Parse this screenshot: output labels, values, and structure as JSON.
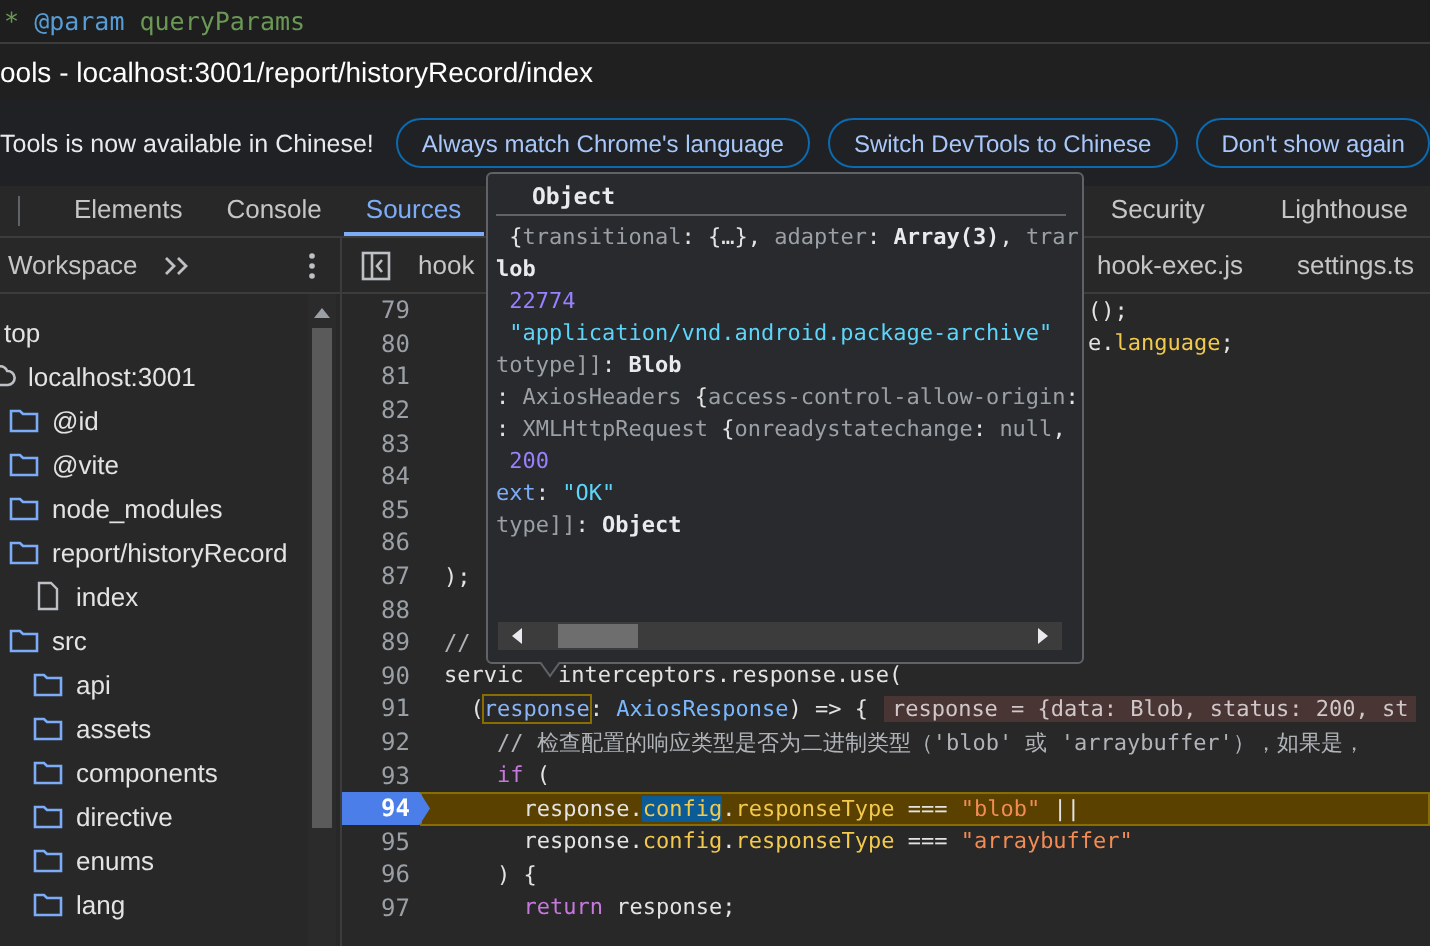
{
  "editor_above": {
    "tokens": [
      {
        "kind": "green",
        "text": "* "
      },
      {
        "kind": "blue",
        "text": "@param"
      },
      {
        "kind": "green",
        "text": " queryParams"
      }
    ]
  },
  "window": {
    "title": "ools - localhost:3001/report/historyRecord/index"
  },
  "infobar": {
    "message": "Tools is now available in Chinese!",
    "buttons": [
      "Always match Chrome's language",
      "Switch DevTools to Chinese",
      "Don't show again"
    ]
  },
  "tabs": [
    {
      "label": "Elements",
      "selected": false
    },
    {
      "label": "Console",
      "selected": false
    },
    {
      "label": "Sources",
      "selected": true
    },
    {
      "label": "Security",
      "selected": false
    },
    {
      "label": "Lighthouse",
      "selected": false
    }
  ],
  "sidebar": {
    "title": "Workspace",
    "tree": [
      {
        "label": "top",
        "children": [
          {
            "label": "localhost:3001",
            "kind": "origin",
            "children": [
              {
                "label": "@id",
                "kind": "folder"
              },
              {
                "label": "@vite",
                "kind": "folder"
              },
              {
                "label": "node_modules",
                "kind": "folder"
              },
              {
                "label": "report/historyRecord",
                "kind": "folder",
                "children": [
                  {
                    "label": "index",
                    "kind": "file"
                  }
                ]
              },
              {
                "label": "src",
                "kind": "folder",
                "children": [
                  {
                    "label": "api",
                    "kind": "folder"
                  },
                  {
                    "label": "assets",
                    "kind": "folder"
                  },
                  {
                    "label": "components",
                    "kind": "folder"
                  },
                  {
                    "label": "directive",
                    "kind": "folder"
                  },
                  {
                    "label": "enums",
                    "kind": "folder"
                  },
                  {
                    "label": "lang",
                    "kind": "folder"
                  }
                ]
              }
            ]
          }
        ]
      }
    ]
  },
  "file_tabs": [
    "hook",
    "hook-exec.js",
    "settings.ts"
  ],
  "code": {
    "lines": [
      {
        "number": "79",
        "paused": false,
        "after_popover": [
          {
            "kind": "plain",
            "text": "();"
          }
        ]
      },
      {
        "number": "80",
        "paused": false,
        "after_popover": [
          {
            "kind": "plain",
            "text": "e."
          },
          {
            "kind": "prop",
            "text": "language"
          },
          {
            "kind": "plain",
            "text": ";"
          }
        ]
      },
      {
        "number": "81",
        "paused": false
      },
      {
        "number": "82",
        "paused": false
      },
      {
        "number": "83",
        "paused": false
      },
      {
        "number": "84",
        "paused": false
      },
      {
        "number": "85",
        "paused": false
      },
      {
        "number": "86",
        "paused": false
      },
      {
        "number": "87",
        "paused": false,
        "tokens": [
          {
            "kind": "plain",
            "text": ");"
          }
        ]
      },
      {
        "number": "88",
        "paused": false
      },
      {
        "number": "89",
        "paused": false,
        "tokens": [
          {
            "kind": "comment",
            "text": "//"
          }
        ]
      },
      {
        "number": "90",
        "paused": false,
        "tokens": [
          {
            "kind": "plain",
            "text": "servic"
          }
        ],
        "after_pointer": [
          {
            "kind": "plain",
            "text": "interceptors.response.use("
          }
        ]
      },
      {
        "number": "91",
        "paused": false,
        "tokens": [
          {
            "kind": "plain",
            "text": "  ("
          },
          {
            "kind": "match",
            "text": "response"
          },
          {
            "kind": "plain",
            "text": ": "
          },
          {
            "kind": "type",
            "text": "AxiosResponse"
          },
          {
            "kind": "plain",
            "text": ") => {"
          }
        ],
        "inline_value": "response = {data: Blob, status: 200, st"
      },
      {
        "number": "92",
        "paused": false,
        "tokens": [
          {
            "kind": "comment",
            "text": "    // 检查配置的响应类型是否为二进制类型（'blob' 或 'arraybuffer'），如果是，"
          }
        ]
      },
      {
        "number": "93",
        "paused": false,
        "tokens": [
          {
            "kind": "kw",
            "text": "    if"
          },
          {
            "kind": "plain",
            "text": " ("
          }
        ]
      },
      {
        "number": "94",
        "paused": true,
        "tokens": [
          {
            "kind": "plain",
            "text": "      response."
          },
          {
            "kind": "selection",
            "text": "config"
          },
          {
            "kind": "plain",
            "text": "."
          },
          {
            "kind": "prop",
            "text": "responseType"
          },
          {
            "kind": "plain",
            "text": " === "
          },
          {
            "kind": "str",
            "text": "\"blob\""
          },
          {
            "kind": "plain",
            "text": " ||"
          }
        ]
      },
      {
        "number": "95",
        "paused": false,
        "tokens": [
          {
            "kind": "plain",
            "text": "      response."
          },
          {
            "kind": "prop",
            "text": "config"
          },
          {
            "kind": "plain",
            "text": "."
          },
          {
            "kind": "prop",
            "text": "responseType"
          },
          {
            "kind": "plain",
            "text": " === "
          },
          {
            "kind": "str",
            "text": "\"arraybuffer\""
          }
        ]
      },
      {
        "number": "96",
        "paused": false,
        "tokens": [
          {
            "kind": "plain",
            "text": "    ) {"
          }
        ]
      },
      {
        "number": "97",
        "paused": false,
        "tokens": [
          {
            "kind": "kw",
            "text": "      return"
          },
          {
            "kind": "plain",
            "text": " response;"
          }
        ]
      }
    ]
  },
  "popover": {
    "title": "Object",
    "lines": [
      [
        {
          "kind": "plain",
          "text": " {"
        },
        {
          "kind": "key",
          "text": "transitional"
        },
        {
          "kind": "plain",
          "text": ": {…}, "
        },
        {
          "kind": "key",
          "text": "adapter"
        },
        {
          "kind": "plain",
          "text": ": "
        },
        {
          "kind": "bold",
          "text": "Array(3)"
        },
        {
          "kind": "plain",
          "text": ", "
        },
        {
          "kind": "key",
          "text": "trar"
        }
      ],
      [
        {
          "kind": "bold",
          "text": "lob"
        }
      ],
      [
        {
          "kind": "num",
          "text": " 22774"
        }
      ],
      [
        {
          "kind": "pstr",
          "text": " \"application/vnd.android.package-archive\""
        }
      ],
      [
        {
          "kind": "key",
          "text": "totype]]"
        },
        {
          "kind": "plain",
          "text": ": "
        },
        {
          "kind": "bold",
          "text": "Blob"
        }
      ],
      [
        {
          "kind": "plain",
          "text": ": "
        },
        {
          "kind": "key",
          "text": "AxiosHeaders "
        },
        {
          "kind": "plain",
          "text": "{"
        },
        {
          "kind": "key",
          "text": "access-control-allow-origin"
        },
        {
          "kind": "plain",
          "text": ":"
        }
      ],
      [
        {
          "kind": "plain",
          "text": ": "
        },
        {
          "kind": "key",
          "text": "XMLHttpRequest "
        },
        {
          "kind": "plain",
          "text": "{"
        },
        {
          "kind": "key",
          "text": "onreadystatechange"
        },
        {
          "kind": "plain",
          "text": ": "
        },
        {
          "kind": "key",
          "text": "null"
        },
        {
          "kind": "plain",
          "text": ","
        }
      ],
      [
        {
          "kind": "num",
          "text": " 200"
        }
      ],
      [
        {
          "kind": "pkey",
          "text": "ext"
        },
        {
          "kind": "plain",
          "text": ": "
        },
        {
          "kind": "pstr",
          "text": "\"OK\""
        }
      ],
      [
        {
          "kind": "key",
          "text": "type]]"
        },
        {
          "kind": "plain",
          "text": ": "
        },
        {
          "kind": "bold",
          "text": "Object"
        }
      ]
    ]
  }
}
